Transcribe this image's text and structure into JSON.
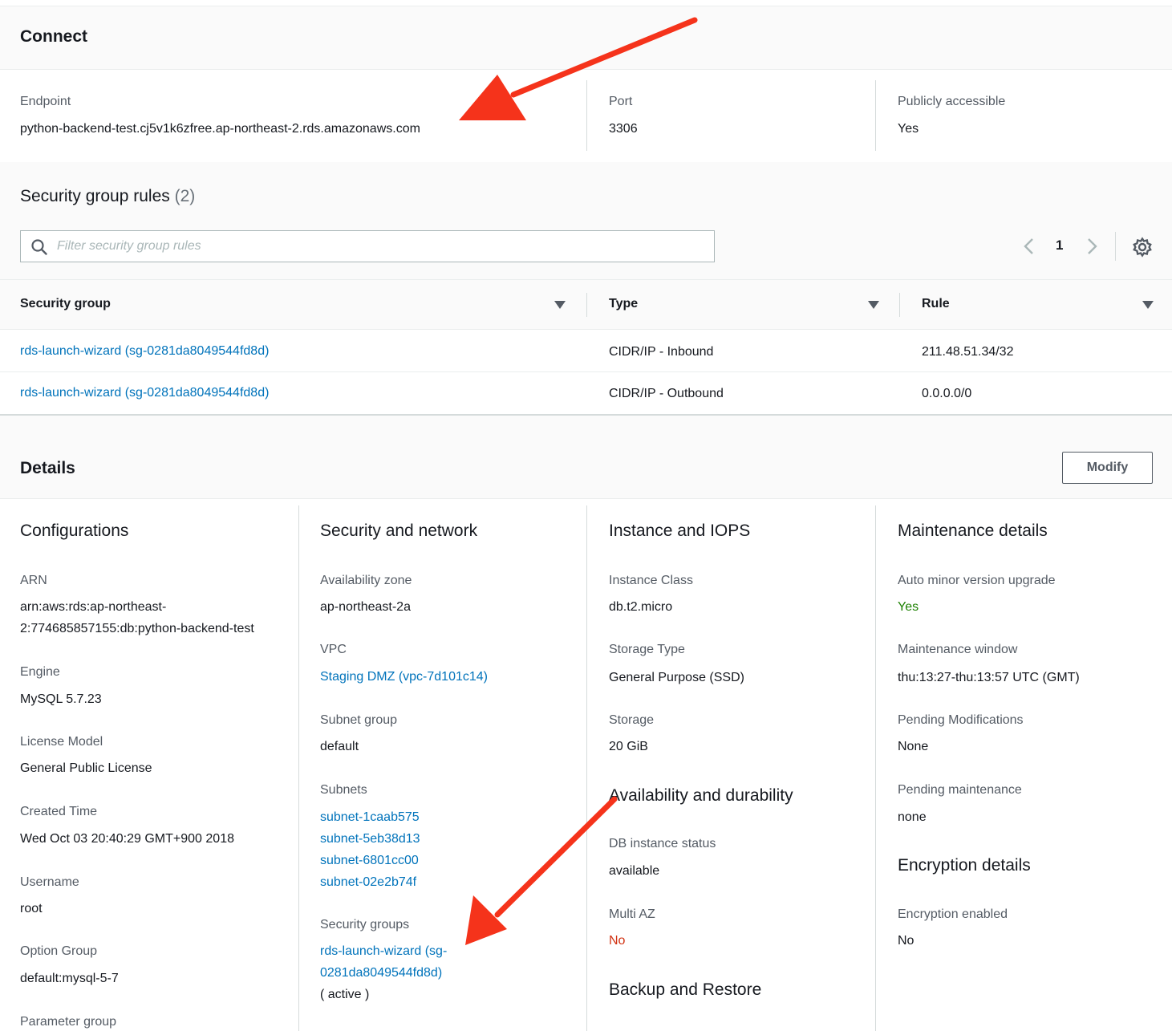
{
  "connect": {
    "title": "Connect",
    "endpoint_label": "Endpoint",
    "endpoint_value": "python-backend-test.cj5v1k6zfree.ap-northeast-2.rds.amazonaws.com",
    "port_label": "Port",
    "port_value": "3306",
    "public_label": "Publicly accessible",
    "public_value": "Yes"
  },
  "security_group_rules": {
    "title": "Security group rules",
    "count": "(2)",
    "search_placeholder": "Filter security group rules",
    "page": "1",
    "columns": [
      "Security group",
      "Type",
      "Rule"
    ],
    "rows": [
      {
        "security_group": "rds-launch-wizard (sg-0281da8049544fd8d)",
        "type": "CIDR/IP - Inbound",
        "rule": "211.48.51.34/32"
      },
      {
        "security_group": "rds-launch-wizard (sg-0281da8049544fd8d)",
        "type": "CIDR/IP - Outbound",
        "rule": "0.0.0.0/0"
      }
    ]
  },
  "details": {
    "title": "Details",
    "modify_label": "Modify",
    "configurations": {
      "title": "Configurations",
      "arn_label": "ARN",
      "arn_line1": "arn:aws:rds:ap-northeast-",
      "arn_line2": "2:774685857155:db:python-backend-test",
      "engine_label": "Engine",
      "engine_value": "MySQL 5.7.23",
      "license_label": "License Model",
      "license_value": "General Public License",
      "created_label": "Created Time",
      "created_value": "Wed Oct 03 20:40:29 GMT+900 2018",
      "username_label": "Username",
      "username_value": "root",
      "option_group_label": "Option Group",
      "option_group_value": "default:mysql-5-7",
      "parameter_group_label": "Parameter group"
    },
    "security_network": {
      "title": "Security and network",
      "az_label": "Availability zone",
      "az_value": "ap-northeast-2a",
      "vpc_label": "VPC",
      "vpc_value": "Staging DMZ (vpc-7d101c14)",
      "subnet_group_label": "Subnet group",
      "subnet_group_value": "default",
      "subnets_label": "Subnets",
      "subnets": [
        "subnet-1caab575",
        "subnet-5eb38d13",
        "subnet-6801cc00",
        "subnet-02e2b74f"
      ],
      "security_groups_label": "Security groups",
      "security_group_line1": "rds-launch-wizard (sg-",
      "security_group_line2": "0281da8049544fd8d)",
      "security_group_status": "( active )"
    },
    "instance_iops": {
      "title": "Instance and IOPS",
      "class_label": "Instance Class",
      "class_value": "db.t2.micro",
      "storage_type_label": "Storage Type",
      "storage_type_value": "General Purpose (SSD)",
      "storage_label": "Storage",
      "storage_value": "20 GiB",
      "availability_title": "Availability and durability",
      "status_label": "DB instance status",
      "status_value": "available",
      "multi_az_label": "Multi AZ",
      "multi_az_value": "No",
      "backup_title": "Backup and Restore"
    },
    "maintenance": {
      "title": "Maintenance details",
      "auto_minor_label": "Auto minor version upgrade",
      "auto_minor_value": "Yes",
      "window_label": "Maintenance window",
      "window_value": "thu:13:27-thu:13:57 UTC (GMT)",
      "pending_mod_label": "Pending Modifications",
      "pending_mod_value": "None",
      "pending_maint_label": "Pending maintenance",
      "pending_maint_value": "none",
      "encryption_title": "Encryption details",
      "encryption_label": "Encryption enabled",
      "encryption_value": "No"
    }
  },
  "colors": {
    "link": "#0073bb",
    "success": "#1d8102",
    "error": "#d13212",
    "annotation_arrow": "#f5331b"
  },
  "icons": [
    "search-icon",
    "chevron-left-icon",
    "chevron-right-icon",
    "gear-icon",
    "sort-caret-icon"
  ]
}
